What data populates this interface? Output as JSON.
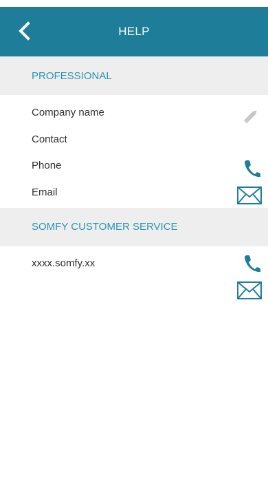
{
  "header": {
    "title": "HELP"
  },
  "professional": {
    "section_title": "PROFESSIONAL",
    "company_label": "Company name",
    "contact_label": "Contact",
    "phone_label": "Phone",
    "email_label": "Email"
  },
  "customer_service": {
    "section_title": "SOMFY CUSTOMER SERVICE",
    "website": "xxxx.somfy.xx"
  },
  "colors": {
    "header_bg": "#1e7d98",
    "accent": "#2a94b1",
    "icon": "#1e7d98",
    "edit_icon": "#c7c7c7",
    "section_bg": "#eeeeee"
  }
}
